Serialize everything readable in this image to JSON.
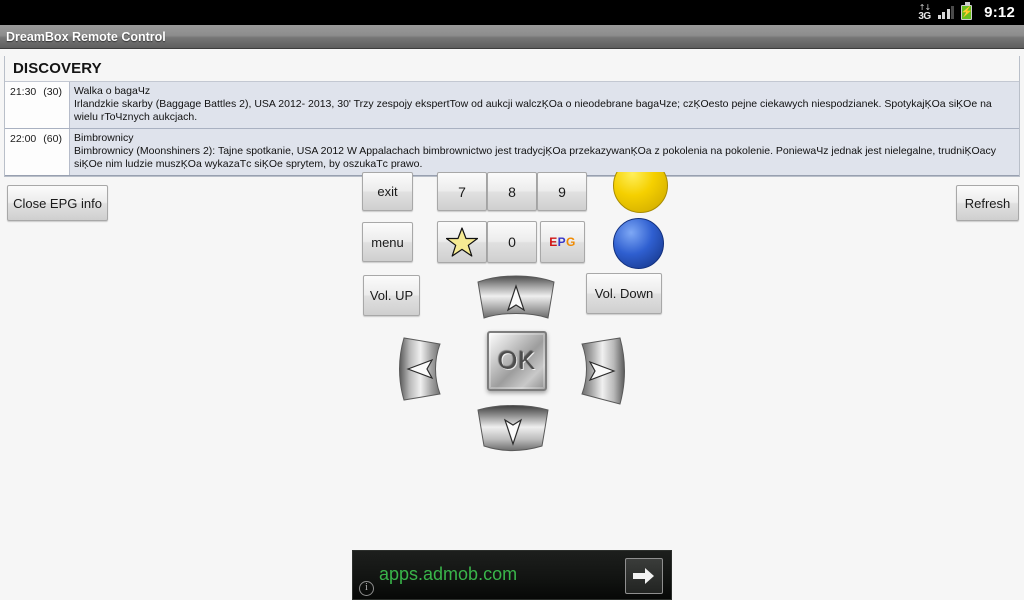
{
  "status_bar": {
    "network_label": "3G",
    "network_arrows": "↑↓",
    "time": "9:12",
    "icons": [
      "3g-icon",
      "signal-bars-icon",
      "battery-icon"
    ]
  },
  "app": {
    "title": "DreamBox Remote Control"
  },
  "epg": {
    "channel": "DISCOVERY",
    "entries": [
      {
        "time": "21:30",
        "duration": "(30)",
        "title": "Walka o bagaЧz",
        "description": "Irlandzkie skarby (Baggage Battles 2), USA 2012- 2013, 30' Trzy zespojy ekspertTow od aukcji walczĶOa o nieodebrane bagaЧze; czĶOesto pejne ciekawych niespodzianek. SpotykajĶOa siĶOe na wielu rToЧznych aukcjach."
      },
      {
        "time": "22:00",
        "duration": "(60)",
        "title": "Bimbrownicy",
        "description": "Bimbrownicy (Moonshiners 2): Tajne spotkanie, USA 2012 W Appalachach bimbrownictwo jest tradycjĶOa przekazywanĶOa z pokolenia na pokolenie. PoniewaЧz jednak jest nielegalne, trudniĶOacy siĶOe nim ludzie muszĶOa wykazaТc siĶOe sprytem, by oszukaТc prawo."
      }
    ]
  },
  "controls": {
    "close_epg": "Close EPG info",
    "refresh": "Refresh",
    "exit": "exit",
    "menu": "menu",
    "vol_up": "Vol. UP",
    "vol_down": "Vol. Down",
    "num_7": "7",
    "num_8": "8",
    "num_9": "9",
    "num_0": "0",
    "star": "☆",
    "epg_label": {
      "e": "E",
      "p": "P",
      "g": "G"
    },
    "ok": "OK",
    "colors": {
      "yellow": "#f5d000",
      "blue": "#2f5fd0"
    }
  },
  "dpad": {
    "up": "up-arrow",
    "down": "down-arrow",
    "left": "left-arrow",
    "right": "right-arrow",
    "center": "OK"
  },
  "ad": {
    "url": "apps.admob.com",
    "info_glyph": "i",
    "cta": "arrow-right-icon",
    "accent_color": "#39b54a"
  }
}
